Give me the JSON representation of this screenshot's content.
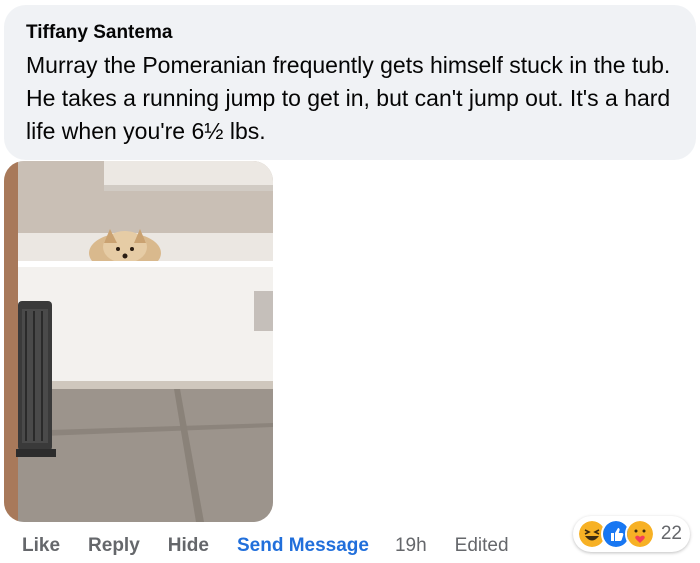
{
  "comment": {
    "author": "Tiffany Santema",
    "text": "Murray the Pomeranian frequently gets himself stuck in the tub. He takes a running jump to get in, but can't jump out. It's a hard life when you're 6½ lbs."
  },
  "photo": {
    "alt": "Pomeranian peeking out of a bathtub"
  },
  "actions": {
    "like": "Like",
    "reply": "Reply",
    "hide": "Hide",
    "send_message": "Send Message",
    "time": "19h",
    "edited": "Edited"
  },
  "reactions": {
    "icons": [
      "haha-icon",
      "like-icon",
      "care-icon"
    ],
    "count": "22"
  },
  "colors": {
    "bubble": "#f0f2f5",
    "link": "#216fdb",
    "secondary_text": "#65676b"
  }
}
